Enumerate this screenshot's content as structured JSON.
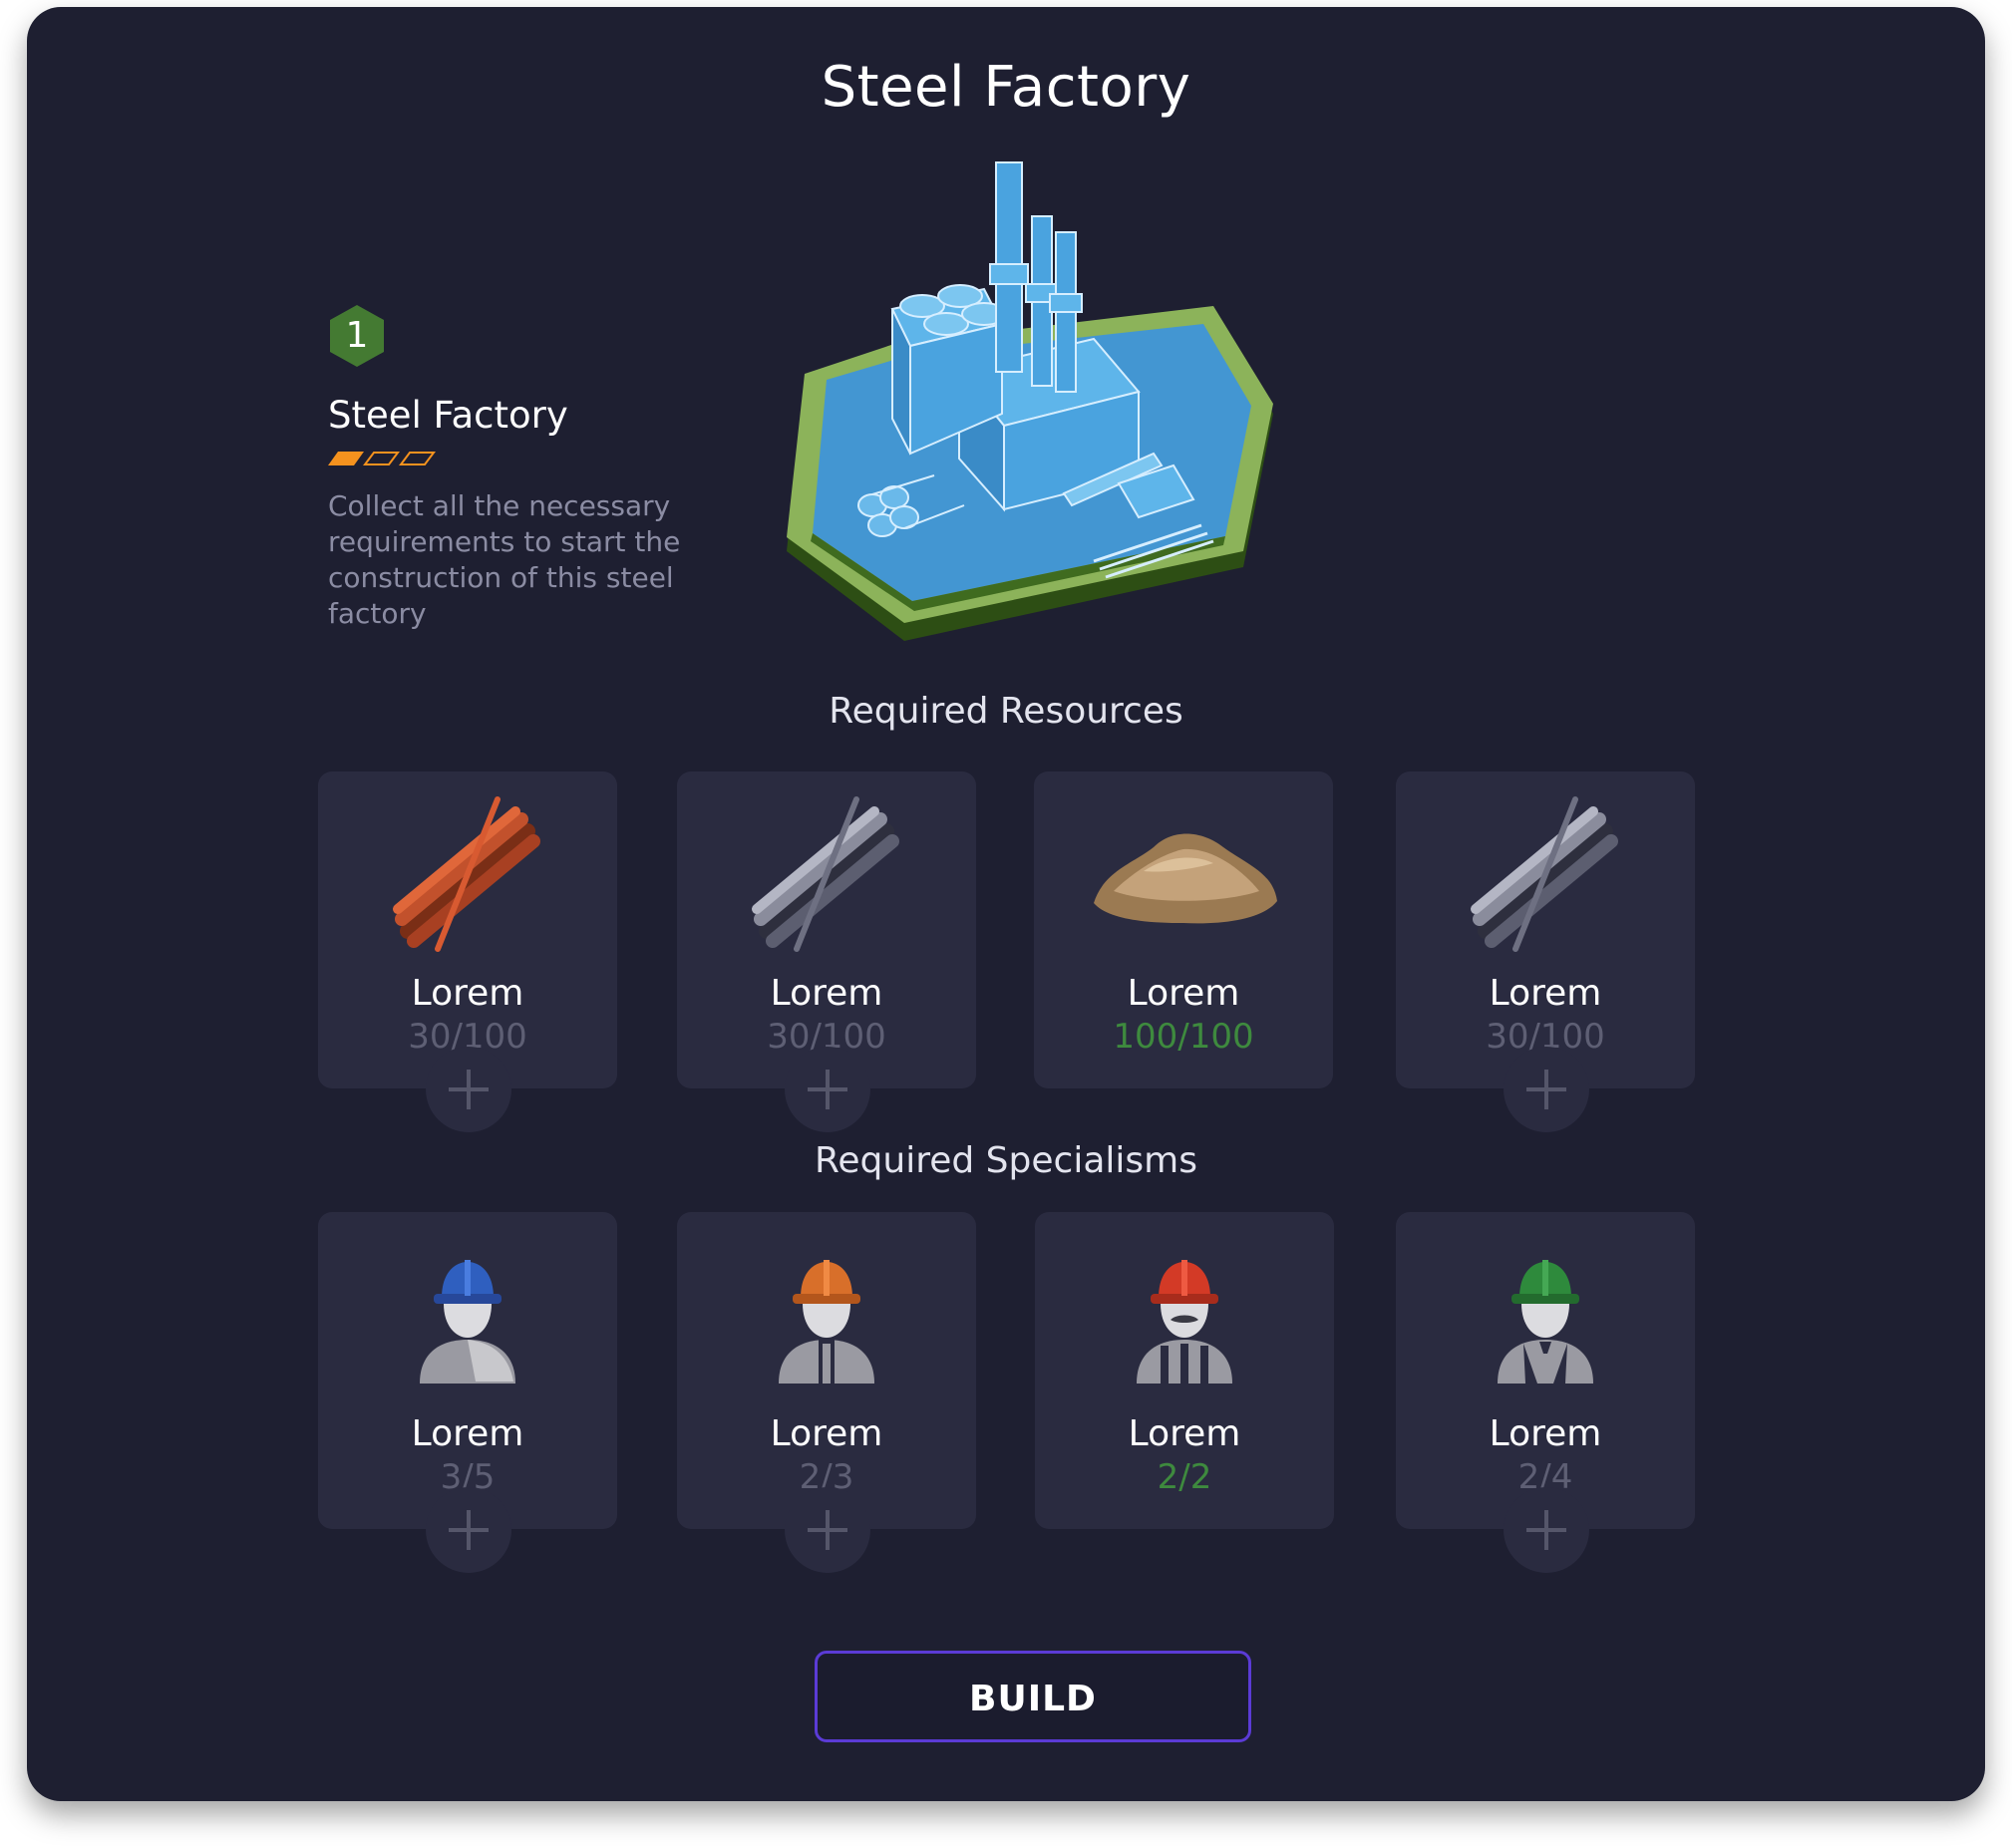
{
  "page": {
    "title": "Steel Factory",
    "level": "1",
    "info_title": "Steel Factory",
    "rating_filled": 1,
    "rating_total": 3,
    "description": "Collect all the necessary requirements to start the construction of this steel factory",
    "build_label": "BUILD",
    "accent_color": "#5b3bd6",
    "complete_color": "#3e8a3e",
    "star_color": "#f5921e"
  },
  "resources": {
    "title": "Required Resources",
    "items": [
      {
        "label": "Lorem",
        "count": "30/100",
        "icon": "copper-rods-icon"
      },
      {
        "label": "Lorem",
        "count": "30/100",
        "icon": "steel-rods-icon"
      },
      {
        "label": "Lorem",
        "count": "100/100",
        "icon": "sand-pile-icon"
      },
      {
        "label": "Lorem",
        "count": "30/100",
        "icon": "steel-rods-icon"
      }
    ]
  },
  "specialisms": {
    "title": "Required Specialisms",
    "items": [
      {
        "label": "Lorem",
        "count": "3/5",
        "icon": "worker-blue-helmet-icon"
      },
      {
        "label": "Lorem",
        "count": "2/3",
        "icon": "worker-orange-helmet-icon"
      },
      {
        "label": "Lorem",
        "count": "2/2",
        "icon": "worker-red-helmet-icon"
      },
      {
        "label": "Lorem",
        "count": "2/4",
        "icon": "worker-green-helmet-icon"
      }
    ]
  }
}
